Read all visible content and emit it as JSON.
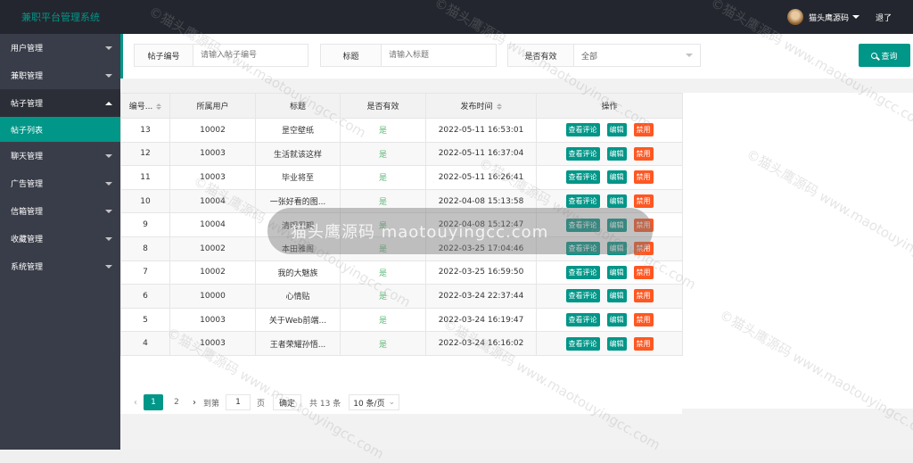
{
  "header": {
    "title": "兼职平台管理系统",
    "user_name": "猫头鹰源码",
    "logout": "退了"
  },
  "sidebar": {
    "items": [
      {
        "label": "用户管理"
      },
      {
        "label": "兼职管理"
      },
      {
        "label": "帖子管理"
      },
      {
        "label": "聊天管理"
      },
      {
        "label": "广告管理"
      },
      {
        "label": "信箱管理"
      },
      {
        "label": "收藏管理"
      },
      {
        "label": "系统管理"
      }
    ],
    "active_sub": "帖子列表"
  },
  "search": {
    "post_id_label": "帖子编号",
    "post_id_placeholder": "请输入帖子编号",
    "title_label": "标题",
    "title_placeholder": "请输入标题",
    "valid_label": "是否有效",
    "valid_value": "全部",
    "button": "查询"
  },
  "table": {
    "headers": [
      "编号...",
      "所属用户",
      "标题",
      "是否有效",
      "发布时间",
      "操作"
    ],
    "rows": [
      {
        "id": "13",
        "user": "10002",
        "title": "昰空壁纸",
        "valid": "是",
        "time": "2022-05-11 16:53:01"
      },
      {
        "id": "12",
        "user": "10003",
        "title": "生活就该这样",
        "valid": "是",
        "time": "2022-05-11 16:37:04"
      },
      {
        "id": "11",
        "user": "10003",
        "title": "毕业将至",
        "valid": "是",
        "time": "2022-05-11 16:26:41"
      },
      {
        "id": "10",
        "user": "10004",
        "title": "一张好看的图...",
        "valid": "是",
        "time": "2022-04-08 15:13:58"
      },
      {
        "id": "9",
        "user": "10004",
        "title": "清明假期",
        "valid": "是",
        "time": "2022-04-08 15:12:47"
      },
      {
        "id": "8",
        "user": "10002",
        "title": "本田雅阁",
        "valid": "是",
        "time": "2022-03-25 17:04:46"
      },
      {
        "id": "7",
        "user": "10002",
        "title": "我的大魅族",
        "valid": "是",
        "time": "2022-03-25 16:59:50"
      },
      {
        "id": "6",
        "user": "10000",
        "title": "心情贴",
        "valid": "是",
        "time": "2022-03-24 22:37:44"
      },
      {
        "id": "5",
        "user": "10003",
        "title": "关于Web前端...",
        "valid": "是",
        "time": "2022-03-24 16:19:47"
      },
      {
        "id": "4",
        "user": "10003",
        "title": "王者荣耀孙悟...",
        "valid": "是",
        "time": "2022-03-24 16:16:02"
      }
    ],
    "actions": {
      "comments": "查看评论",
      "edit": "编辑",
      "disable": "禁用"
    }
  },
  "pager": {
    "page1": "1",
    "page2": "2",
    "goto": "到第",
    "input": "1",
    "page_unit": "页",
    "confirm": "确定",
    "total": "共 13 条",
    "size": "10 条/页"
  },
  "watermark": "©猫头鹰源码 www.maotouyingcc.com",
  "overlay_text": "猫头鹰源码 maotouyingcc.com",
  "colors": {
    "accent": "#009688",
    "danger": "#ff5722",
    "sidebar": "#393d49",
    "header": "#23262e"
  }
}
